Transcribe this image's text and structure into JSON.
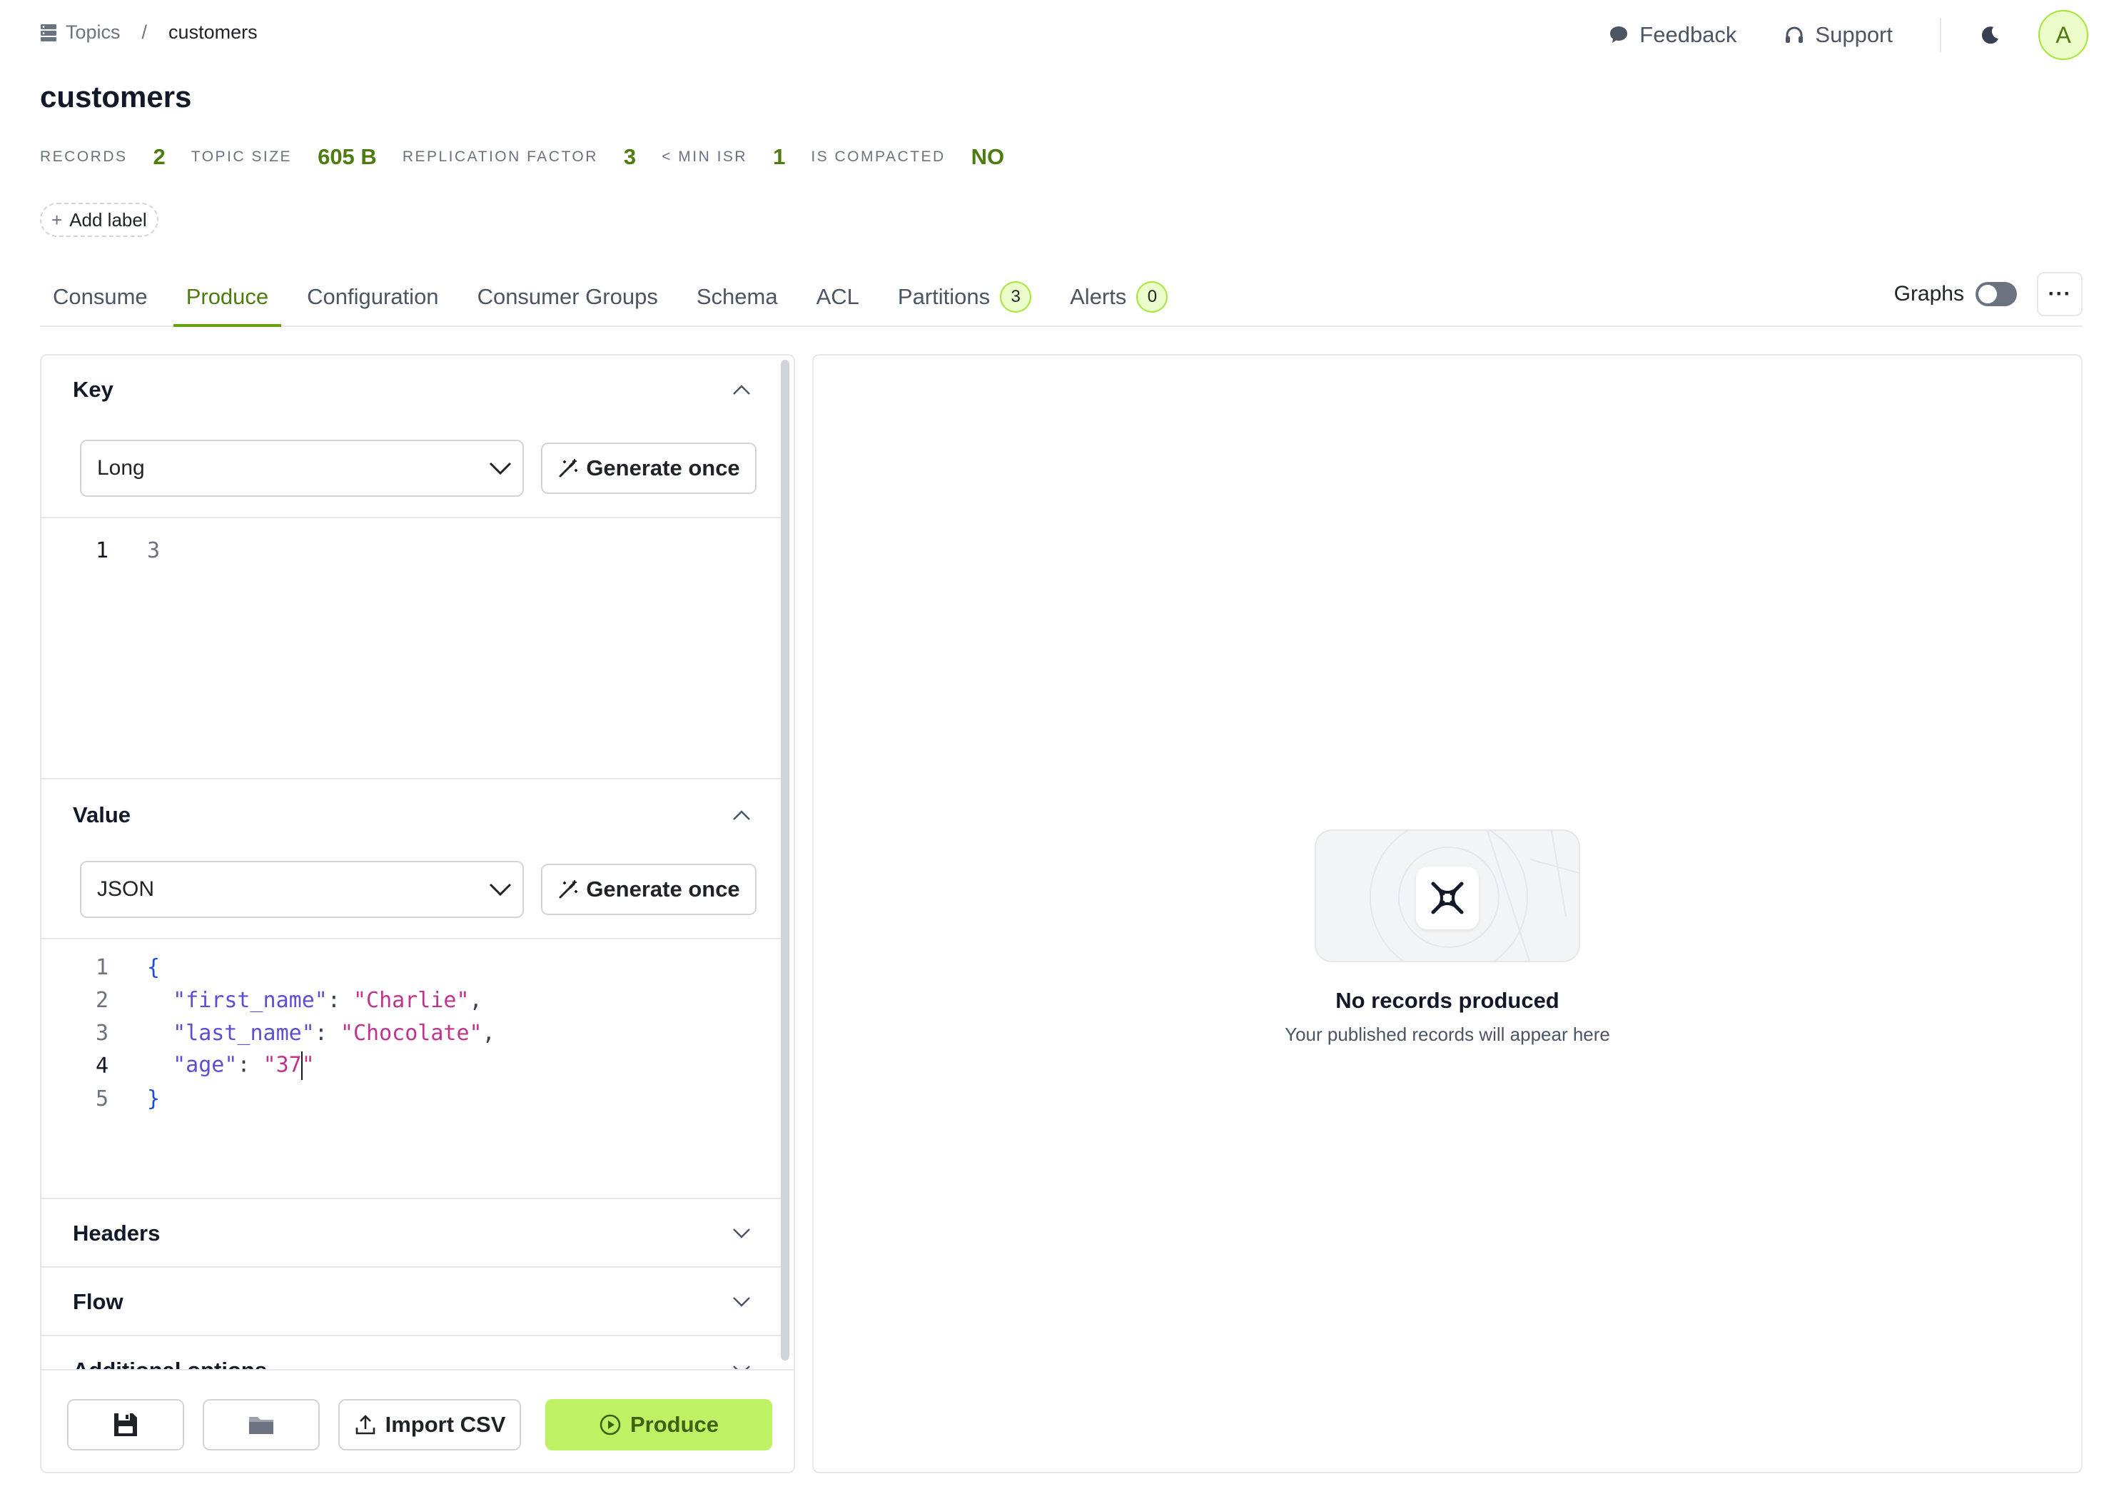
{
  "breadcrumb": {
    "root": "Topics",
    "separator": "/",
    "current": "customers"
  },
  "top_actions": {
    "feedback": "Feedback",
    "support": "Support",
    "avatar_initial": "A"
  },
  "page": {
    "title": "customers"
  },
  "stats": [
    {
      "label": "RECORDS",
      "value": "2"
    },
    {
      "label": "TOPIC SIZE",
      "value": "605 B"
    },
    {
      "label": "REPLICATION FACTOR",
      "value": "3"
    },
    {
      "label": "< MIN ISR",
      "value": "1"
    },
    {
      "label": "IS COMPACTED",
      "value": "NO"
    }
  ],
  "add_label": {
    "plus": "+",
    "text": "Add label"
  },
  "tabs": [
    {
      "label": "Consume"
    },
    {
      "label": "Produce",
      "active": true
    },
    {
      "label": "Configuration"
    },
    {
      "label": "Consumer Groups"
    },
    {
      "label": "Schema"
    },
    {
      "label": "ACL"
    },
    {
      "label": "Partitions",
      "badge": "3"
    },
    {
      "label": "Alerts",
      "badge": "0"
    }
  ],
  "graphs": {
    "label": "Graphs",
    "enabled": false,
    "more": "···"
  },
  "key_section": {
    "title": "Key",
    "type": "Long",
    "generate": "Generate once",
    "lines": [
      {
        "num": "1",
        "text": "3"
      }
    ]
  },
  "value_section": {
    "title": "Value",
    "type": "JSON",
    "generate": "Generate once",
    "line_numbers": [
      "1",
      "2",
      "3",
      "4",
      "5"
    ],
    "json": {
      "open": "{",
      "k1": "\"first_name\"",
      "v1": "\"Charlie\"",
      "k2": "\"last_name\"",
      "v2": "\"Chocolate\"",
      "k3": "\"age\"",
      "v3a": "\"37",
      "v3b": "\"",
      "colon": ": ",
      "comma": ",",
      "close": "}"
    }
  },
  "collapsed_sections": [
    {
      "title": "Headers"
    },
    {
      "title": "Flow"
    },
    {
      "title": "Additional options"
    }
  ],
  "bottom_actions": {
    "import_csv": "Import CSV",
    "produce": "Produce"
  },
  "empty_state": {
    "title": "No records produced",
    "subtitle": "Your published records will appear here"
  },
  "colors": {
    "accent": "#65a30d",
    "accent_text": "#4d7c0f",
    "produce_bg": "#bef264",
    "badge_bg": "#ecfccb"
  }
}
